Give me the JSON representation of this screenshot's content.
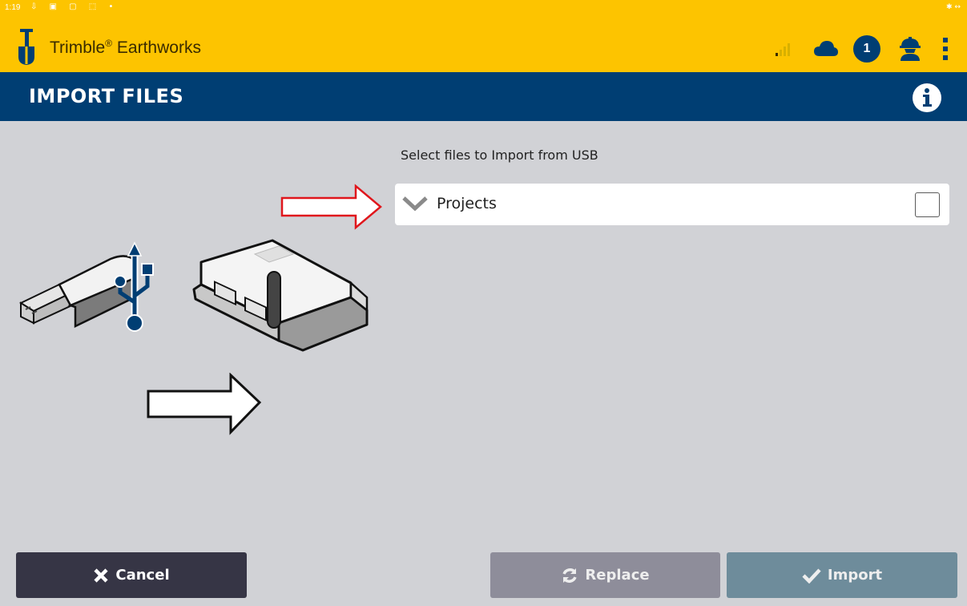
{
  "status_bar": {
    "time": "1:19",
    "icons": "⇩ ▣ ▢ ⬚ •",
    "right": "✱ ↔"
  },
  "app": {
    "title": "Trimble",
    "title_mark": "®",
    "title_suffix": " Earthworks",
    "notification_count": "1"
  },
  "page": {
    "title": "IMPORT FILES"
  },
  "content": {
    "instruction": "Select files to Import from USB",
    "tree_items": [
      {
        "label": "Projects",
        "checked": false,
        "expanded": false
      }
    ]
  },
  "buttons": {
    "cancel": "Cancel",
    "replace": "Replace",
    "import": "Import"
  },
  "colors": {
    "app_bar": "#fdc400",
    "header": "#003e73",
    "background": "#d1d2d6",
    "cancel_button": "#363545",
    "replace_button": "#8e8d9a",
    "import_button": "#6e8c9b",
    "annotation_arrow": "#e0161c"
  },
  "icons": {
    "app_logo": "shovel-logo-icon",
    "signal": "signal-strength-icon",
    "cloud": "cloud-icon",
    "worker": "worker-hardhat-icon",
    "menu": "more-vert-icon",
    "info": "info-icon",
    "chevron": "chevron-down-icon",
    "cancel": "close-icon",
    "replace": "refresh-icon",
    "import": "checkmark-icon"
  }
}
